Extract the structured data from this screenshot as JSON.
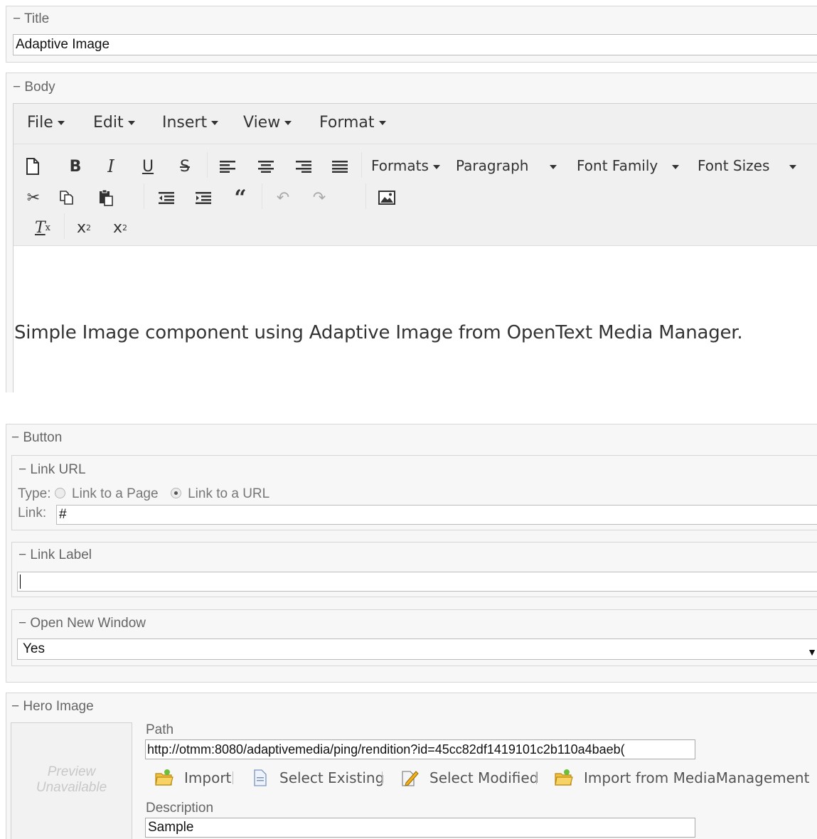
{
  "title_section": {
    "legend": "− Title",
    "value": "Adaptive Image"
  },
  "body_section": {
    "legend": "− Body",
    "menubar": [
      "File",
      "Edit",
      "Insert",
      "View",
      "Format"
    ],
    "toolbar": {
      "formats": "Formats",
      "paragraph": "Paragraph",
      "font_family": "Font Family",
      "font_sizes": "Font Sizes",
      "icons_row1": [
        "new-document-icon",
        "bold-icon",
        "italic-icon",
        "underline-icon",
        "strikethrough-icon",
        "align-left-icon",
        "align-center-icon",
        "align-right-icon",
        "justify-icon"
      ],
      "icons_row2": [
        "cut-icon",
        "copy-icon",
        "paste-icon",
        "outdent-icon",
        "indent-icon",
        "blockquote-icon",
        "undo-icon",
        "redo-icon",
        "image-icon"
      ],
      "icons_row3": [
        "clear-formatting-icon",
        "subscript-icon",
        "superscript-icon"
      ]
    },
    "content": "Simple Image component using Adaptive Image from OpenText Media Manager."
  },
  "button_section": {
    "legend": "− Button",
    "link_url": {
      "legend": "− Link URL",
      "type_label": "Type:",
      "option_page": "Link to a Page",
      "option_url": "Link to a URL",
      "selected": "Link to a URL",
      "link_label": "Link:",
      "link_value": "#"
    },
    "link_label_section": {
      "legend": "− Link Label",
      "value": ""
    },
    "open_new_window": {
      "legend": "− Open New Window",
      "selected": "Yes"
    }
  },
  "hero_image": {
    "legend": "− Hero Image",
    "preview_line1": "Preview",
    "preview_line2": "Unavailable",
    "path_label": "Path",
    "path_value": "http://otmm:8080/adaptivemedia/ping/rendition?id=45cc82df1419101c2b110a4baeb(",
    "actions": [
      "Import",
      "Select Existing",
      "Select Modified",
      "Import from MediaManagement"
    ],
    "description_label": "Description",
    "description_value": "Sample"
  },
  "colors": {
    "panel_bg": "#f7f7f7",
    "border": "#d6d6d6",
    "legend_text": "#666666"
  }
}
